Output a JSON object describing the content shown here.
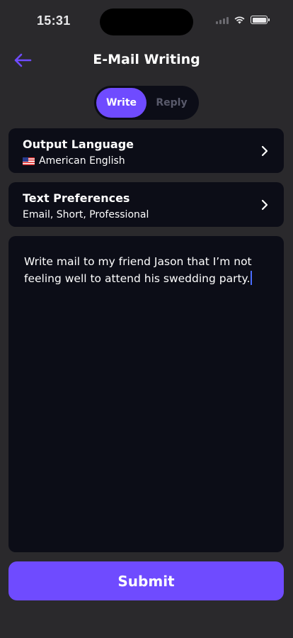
{
  "status_bar": {
    "time": "15:31",
    "battery_level": 1.0
  },
  "header": {
    "title": "E-Mail Writing",
    "back_icon": "arrow-left-icon",
    "accent_color": "#6f4bff"
  },
  "mode_tabs": [
    {
      "label": "Write",
      "active": true
    },
    {
      "label": "Reply",
      "active": false
    }
  ],
  "output_language": {
    "title": "Output Language",
    "value": "American English",
    "flag_icon": "us-flag-icon"
  },
  "text_preferences": {
    "title": "Text Preferences",
    "value": "Email, Short, Professional"
  },
  "prompt": {
    "text": "Write mail to my friend Jason that I’m not feeling well to attend his swedding party."
  },
  "submit": {
    "label": "Submit"
  }
}
